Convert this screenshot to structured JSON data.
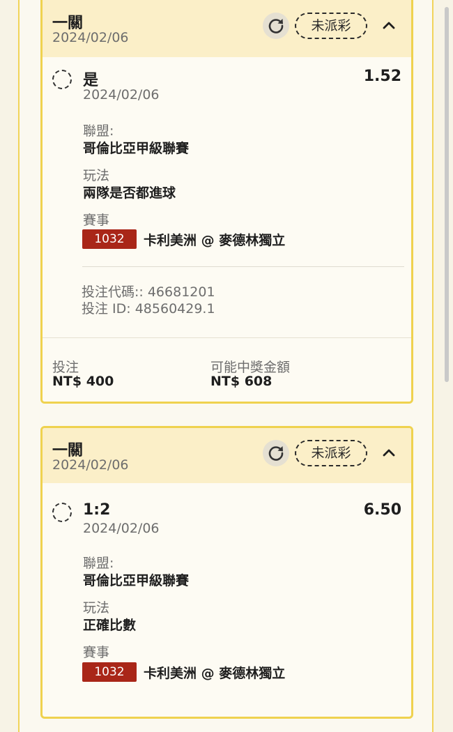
{
  "bets": [
    {
      "bet_type": "一關",
      "date": "2024/02/06",
      "status": "未派彩",
      "selection": "是",
      "selection_date": "2024/02/06",
      "odds": "1.52",
      "league_label": "聯盟:",
      "league": "哥倫比亞甲級聯賽",
      "market_label": "玩法",
      "market": "兩隊是否都進球",
      "event_label": "賽事",
      "match_id": "1032",
      "match": "卡利美洲 @ 麥德林獨立",
      "bet_code": "投注代碼:: 46681201",
      "bet_id": "投注 ID: 48560429.1",
      "stake_label": "投注",
      "stake": "NT$ 400",
      "payout_label": "可能中獎金額",
      "payout": "NT$ 608"
    },
    {
      "bet_type": "一關",
      "date": "2024/02/06",
      "status": "未派彩",
      "selection": "1:2",
      "selection_date": "2024/02/06",
      "odds": "6.50",
      "league_label": "聯盟:",
      "league": "哥倫比亞甲級聯賽",
      "market_label": "玩法",
      "market": "正確比數",
      "event_label": "賽事",
      "match_id": "1032",
      "match": "卡利美洲 @ 麥德林獨立"
    }
  ],
  "icons": {
    "refresh": "refresh-icon",
    "collapse": "chevron-up-icon",
    "radio": "radio-unselected-icon"
  },
  "colors": {
    "card_border": "#efd24f",
    "header_bg": "#fbefc8",
    "match_badge": "#a92618"
  }
}
